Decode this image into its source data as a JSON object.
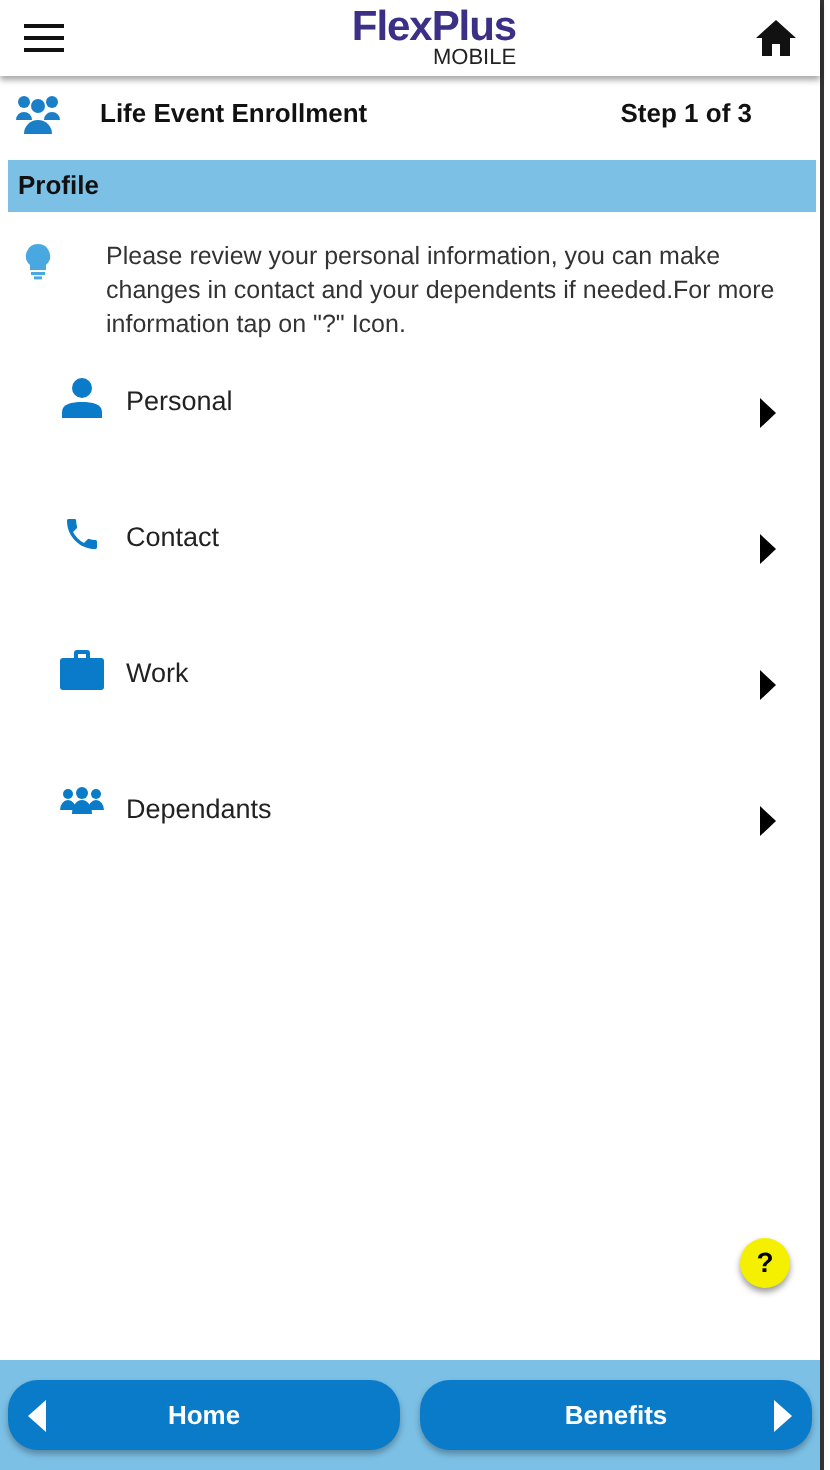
{
  "header": {
    "logo_title": "FlexPlus",
    "logo_subtitle": "MOBILE"
  },
  "subheader": {
    "title": "Life Event Enrollment",
    "step": "Step 1 of 3"
  },
  "section": {
    "title": "Profile"
  },
  "hint": "Please review your personal information, you can make changes in contact and  your dependents if needed.For more information tap on \"?\" Icon.",
  "items": [
    {
      "label": "Personal"
    },
    {
      "label": "Contact"
    },
    {
      "label": "Work"
    },
    {
      "label": "Dependants"
    }
  ],
  "help_button": "?",
  "footer": {
    "back": "Home",
    "next": "Benefits"
  }
}
